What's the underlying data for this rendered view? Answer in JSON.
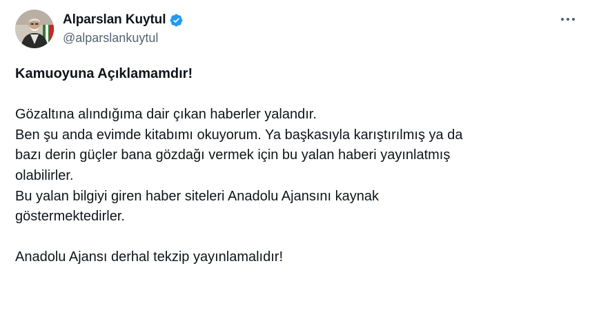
{
  "author": {
    "display_name": "Alparslan Kuytul",
    "handle": "@alparslankuytul",
    "avatar_icon": "profile-photo",
    "verified_icon": "verified-badge-icon"
  },
  "actions": {
    "more_icon": "more-horizontal-icon"
  },
  "tweet": {
    "headline": "Kamuoyuna Açıklamamdır!",
    "lines": [
      "Gözaltına alındığıma dair çıkan haberler yalandır.",
      "Ben şu anda evimde kitabımı okuyorum. Ya başkasıyla karıştırılmış ya da",
      "bazı derin güçler bana gözdağı vermek için bu yalan haberi yayınlatmış",
      "olabilirler.",
      "Bu yalan bilgiyi giren haber siteleri Anadolu Ajansını kaynak",
      "göstermektedirler."
    ],
    "closing": "Anadolu Ajansı derhal tekzip yayınlamalıdır!"
  },
  "colors": {
    "verified_blue": "#1d9bf0",
    "text_primary": "#0f1419",
    "text_secondary": "#536471"
  }
}
